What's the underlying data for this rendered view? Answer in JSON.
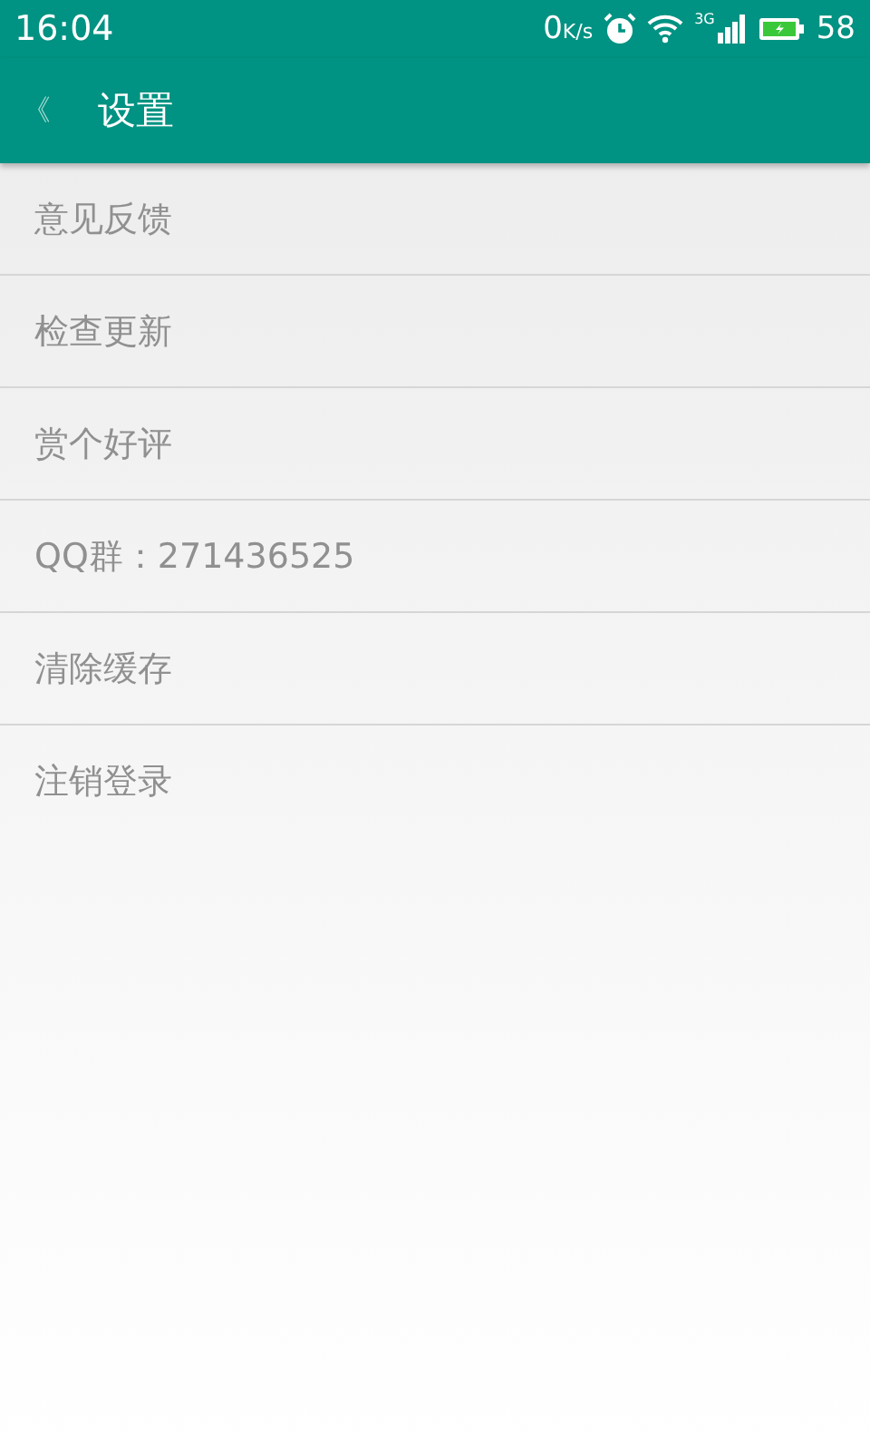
{
  "status_bar": {
    "time": "16:04",
    "speed": "0",
    "speed_unit": "K/s",
    "network": "3G",
    "battery": "58"
  },
  "app_bar": {
    "back": "《",
    "title": "设置"
  },
  "menu": [
    {
      "label": "意见反馈"
    },
    {
      "label": "检查更新"
    },
    {
      "label": "赏个好评"
    },
    {
      "label": "QQ群：271436525"
    },
    {
      "label": "清除缓存"
    },
    {
      "label": "注销登录"
    }
  ]
}
